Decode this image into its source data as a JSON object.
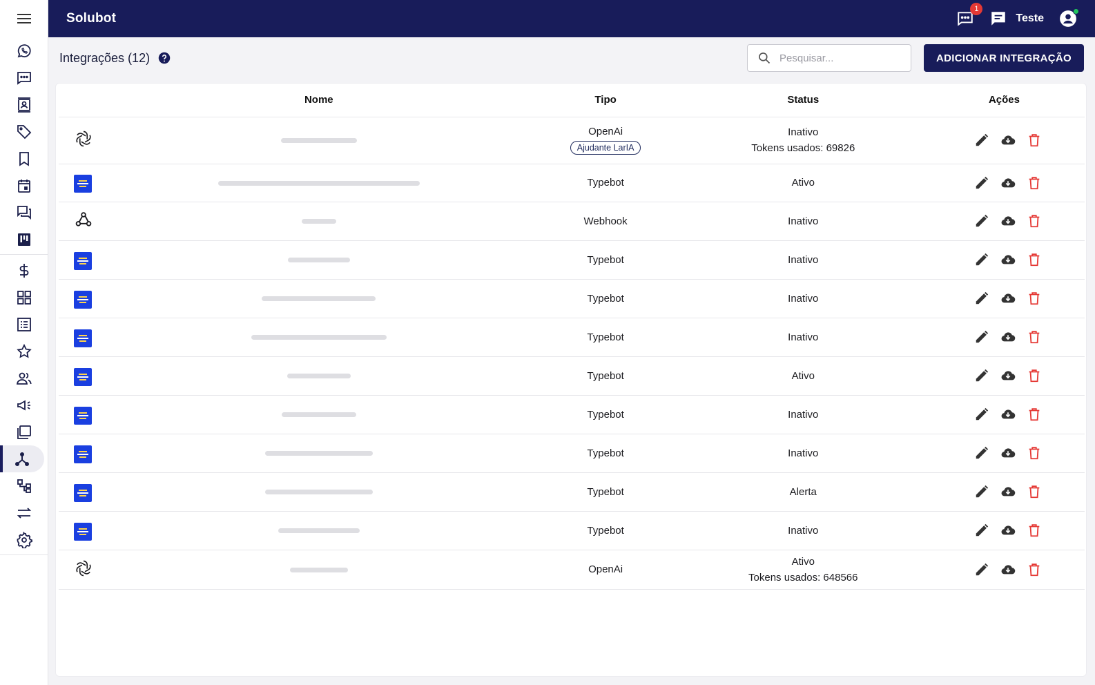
{
  "app": {
    "brand": "Solubot",
    "notifications_count": "1",
    "user_name": "Teste"
  },
  "page": {
    "title": "Integrações (12)",
    "search_placeholder": "Pesquisar...",
    "add_button": "ADICIONAR INTEGRAÇÃO"
  },
  "table": {
    "columns": {
      "nome": "Nome",
      "tipo": "Tipo",
      "status": "Status",
      "acoes": "Ações"
    },
    "rows": [
      {
        "icon": "openai-icon",
        "tipo": "OpenAi",
        "tag": "Ajudante LarIA",
        "status": "Inativo",
        "tokens": "Tokens usados: 69826"
      },
      {
        "icon": "typebot-icon",
        "tipo": "Typebot",
        "status": "Ativo"
      },
      {
        "icon": "webhook-icon",
        "tipo": "Webhook",
        "status": "Inativo"
      },
      {
        "icon": "typebot-icon",
        "tipo": "Typebot",
        "status": "Inativo"
      },
      {
        "icon": "typebot-icon",
        "tipo": "Typebot",
        "status": "Inativo"
      },
      {
        "icon": "typebot-icon",
        "tipo": "Typebot",
        "status": "Inativo"
      },
      {
        "icon": "typebot-icon",
        "tipo": "Typebot",
        "status": "Ativo"
      },
      {
        "icon": "typebot-icon",
        "tipo": "Typebot",
        "status": "Inativo"
      },
      {
        "icon": "typebot-icon",
        "tipo": "Typebot",
        "status": "Inativo"
      },
      {
        "icon": "typebot-icon",
        "tipo": "Typebot",
        "status": "Alerta"
      },
      {
        "icon": "typebot-icon",
        "tipo": "Typebot",
        "status": "Inativo"
      },
      {
        "icon": "openai-icon",
        "tipo": "OpenAi",
        "status": "Ativo",
        "tokens": "Tokens usados: 648566"
      }
    ]
  },
  "sidebar": {
    "items": [
      "whatsapp-icon",
      "chat-dots-icon",
      "contact-card-icon",
      "tag-icon",
      "bookmark-icon",
      "calendar-icon",
      "chat-bubbles-icon",
      "kanban-icon",
      "dollar-icon",
      "grid-icon",
      "list-icon",
      "star-icon",
      "users-icon",
      "megaphone-icon",
      "folders-icon",
      "integration-icon",
      "flow-icon",
      "arrows-icon",
      "gear-icon"
    ],
    "active": "integration-icon"
  },
  "colors": {
    "primary": "#181c5a",
    "danger": "#e53935",
    "online": "#22c55e",
    "typebot": "#1a3fe0"
  }
}
